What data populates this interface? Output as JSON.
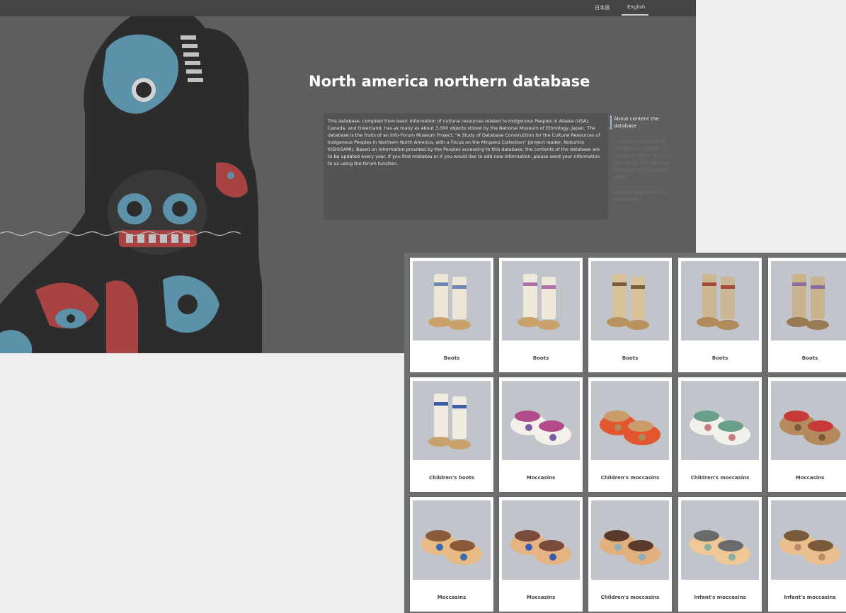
{
  "site": {
    "languages": [
      "日本語",
      "English"
    ],
    "title": "North america northern database",
    "description": "This database, compiled from basic information of cultural resources related to Indigenous Peoples in Alaska (USA), Canada, and Greenland, has as many as about 3,000 objects stored by the National Museum of Ethnology, Japan. The database is the fruits of an Info-Forum Museum Project, \"A Study of Database Construction for the Cultural Resources of Indigenous Peoples in Northern North America, with a Focus on the Minpaku Collection\" (project leader: Nobuhiro KISHIGAMI). Based on information provided by the Peoples accessing to this database, the contents of the database are to be updated every year. If you find mistakes or if you would like to add new information, please send your information to us using the forum function.",
    "side_menu": [
      {
        "label": "About content the database",
        "active": true
      },
      {
        "label": "Cultural resources of Indigenous Peoples in Northern North America owned by the National Museum of Ethnology, Japan",
        "active": false
      },
      {
        "label": "About Indigenous the database",
        "active": false
      }
    ]
  },
  "colors": {
    "overlay": "#5e5e5e",
    "art_black": "#1a1a1a",
    "art_blue": "#5aa7c6",
    "art_red": "#c43a3a",
    "menu_accent": "#9fb6cf"
  },
  "grid": {
    "items": [
      {
        "label": "Boots",
        "icon": "boots-image"
      },
      {
        "label": "Boots",
        "icon": "boots-image"
      },
      {
        "label": "Boots",
        "icon": "boots-image"
      },
      {
        "label": "Boots",
        "icon": "boots-image"
      },
      {
        "label": "Boots",
        "icon": "boots-image"
      },
      {
        "label": "Children's boots",
        "icon": "boots-image"
      },
      {
        "label": "Moccasins",
        "icon": "moccasins-image"
      },
      {
        "label": "Children's moccasins",
        "icon": "moccasins-image"
      },
      {
        "label": "Children's moccasins",
        "icon": "moccasins-image"
      },
      {
        "label": "Moccasins",
        "icon": "moccasins-image"
      },
      {
        "label": "Moccasins",
        "icon": "moccasins-image"
      },
      {
        "label": "Moccasins",
        "icon": "moccasins-image"
      },
      {
        "label": "Children's moccasins",
        "icon": "moccasins-image"
      },
      {
        "label": "Infant's moccasins",
        "icon": "moccasins-image"
      },
      {
        "label": "Infant's moccasins",
        "icon": "moccasins-image"
      }
    ]
  }
}
